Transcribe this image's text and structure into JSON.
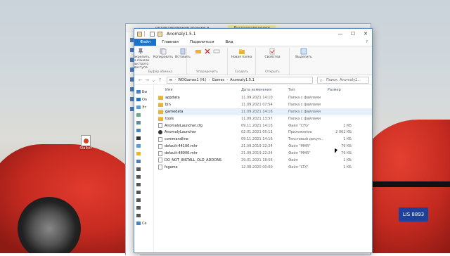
{
  "desktop": {
    "icon_label": "Stalker",
    "plate_text": "LIS 8893"
  },
  "back_window": {
    "title": "редактирование музыки в ...",
    "play_tab": "Воспроизведение"
  },
  "window": {
    "title": "Anomaly1.5.1",
    "controls": {
      "minimize": "—",
      "maximize": "☐",
      "close": "✕"
    },
    "ribbon_tabs": [
      "Файл",
      "Главная",
      "Поделиться",
      "Вид"
    ],
    "help": "?",
    "ribbon": {
      "pin_label": "Закрепить на панели быстрого доступа",
      "copy_label": "Копировать",
      "paste_label": "Вставить",
      "clipboard_group": "Буфер обмена",
      "organize_group": "Упорядочить",
      "new_folder_label": "Новая папка",
      "create_group": "Создать",
      "properties_label": "Свойства",
      "open_group": "Открыть",
      "select_label": "Выделить"
    },
    "address": {
      "segments": [
        "WDGames1 (H:)",
        "Games",
        "Anomaly1.5.1"
      ]
    },
    "search_placeholder": "Поиск: Anomaly1...",
    "nav_pane": [
      "Бы",
      "On",
      "Эт",
      "",
      "",
      "",
      "",
      "",
      "",
      "",
      "",
      "",
      "",
      "",
      "",
      "",
      "",
      "Се"
    ],
    "columns": {
      "name": "Имя",
      "date": "Дата изменения",
      "type": "Тип",
      "size": "Размер"
    },
    "files": [
      {
        "name": "appdata",
        "date": "11.09.2021 14:10",
        "type": "Папка с файлами",
        "size": "",
        "kind": "folder"
      },
      {
        "name": "bin",
        "date": "11.09.2021 07:54",
        "type": "Папка с файлами",
        "size": "",
        "kind": "folder"
      },
      {
        "name": "gamedata",
        "date": "11.09.2021 14:16",
        "type": "Папка с файлами",
        "size": "",
        "kind": "folder"
      },
      {
        "name": "tools",
        "date": "11.09.2021 13:57",
        "type": "Папка с файлами",
        "size": "",
        "kind": "folder"
      },
      {
        "name": "AnomalyLauncher.cfg",
        "date": "09.11.2021 14:16",
        "type": "Файл \"CFG\"",
        "size": "1 КБ",
        "kind": "doc"
      },
      {
        "name": "AnomalyLauncher",
        "date": "02.01.2021 05:13",
        "type": "Приложение",
        "size": "2 062 КБ",
        "kind": "app"
      },
      {
        "name": "commandline",
        "date": "09.11.2021 14:16",
        "type": "Текстовый докум...",
        "size": "1 КБ",
        "kind": "doc"
      },
      {
        "name": "default-44100.mhr",
        "date": "21.09.2019 22:24",
        "type": "Файл \"MHR\"",
        "size": "79 КБ",
        "kind": "doc"
      },
      {
        "name": "default-48000.mhr",
        "date": "21.09.2019 22:24",
        "type": "Файл \"MHR\"",
        "size": "79 КБ",
        "kind": "doc"
      },
      {
        "name": "DO_NOT_INSTALL_OLD_ADDONS",
        "date": "29.01.2021 18:56",
        "type": "Файл",
        "size": "1 КБ",
        "kind": "doc"
      },
      {
        "name": "fsgame",
        "date": "12.08.2020 00:00",
        "type": "Файл \"LTX\"",
        "size": "1 КБ",
        "kind": "doc"
      }
    ]
  }
}
